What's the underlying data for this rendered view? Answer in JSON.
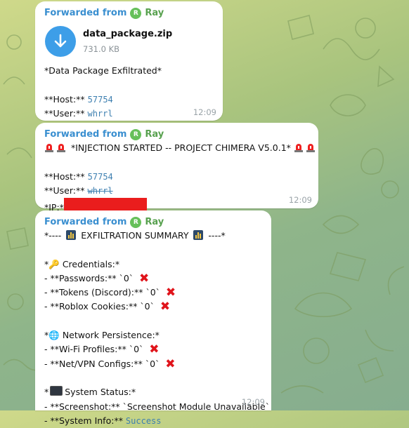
{
  "theme": {
    "accent": "#3a8fd0",
    "sender_color": "#58a14f",
    "alert_red": "#e0141b",
    "download_blue": "#3d9ee8"
  },
  "messages": [
    {
      "forwarded_label": "Forwarded from",
      "sender": "Ray",
      "avatar_letter": "R",
      "file": {
        "name": "data_package.zip",
        "size": "731.0 KB",
        "icon": "download-arrow-icon"
      },
      "title": "*Data Package Exfiltrated*",
      "host_label": "**Host:** ",
      "host_value": "57754",
      "user_label": "**User:** ",
      "user_value": "whrrl",
      "time": "12:09"
    },
    {
      "forwarded_label": "Forwarded from",
      "sender": "Ray",
      "avatar_letter": "R",
      "title": "*INJECTION STARTED -- PROJECT CHIMERA V5.0.1*",
      "host_label": "**Host:** ",
      "host_value": "57754",
      "user_label": "**User:** ",
      "user_value": "whrrl",
      "ip_label": "*IP:*",
      "time": "12:09"
    },
    {
      "forwarded_label": "Forwarded from",
      "sender": "Ray",
      "avatar_letter": "R",
      "summary_prefix": "*----",
      "summary_title": "EXFILTRATION SUMMARY",
      "summary_suffix": "----*",
      "credentials_header": "Credentials:*",
      "passwords_line": "- **Passwords:** `0`",
      "tokens_line": "- **Tokens (Discord):** `0`",
      "roblox_line": "- **Roblox Cookies:** `0`",
      "network_header": "Network Persistence:*",
      "wifi_line": "- **Wi-Fi Profiles:** `0`",
      "vpn_line": "- **Net/VPN Configs:** `0`",
      "system_header": "System Status:*",
      "screenshot_line": "- **Screenshot:** `Screenshot Module Unavailable`",
      "sysinfo_label": "- **System Info:** ",
      "sysinfo_value": "Success",
      "time": "12:09"
    }
  ]
}
